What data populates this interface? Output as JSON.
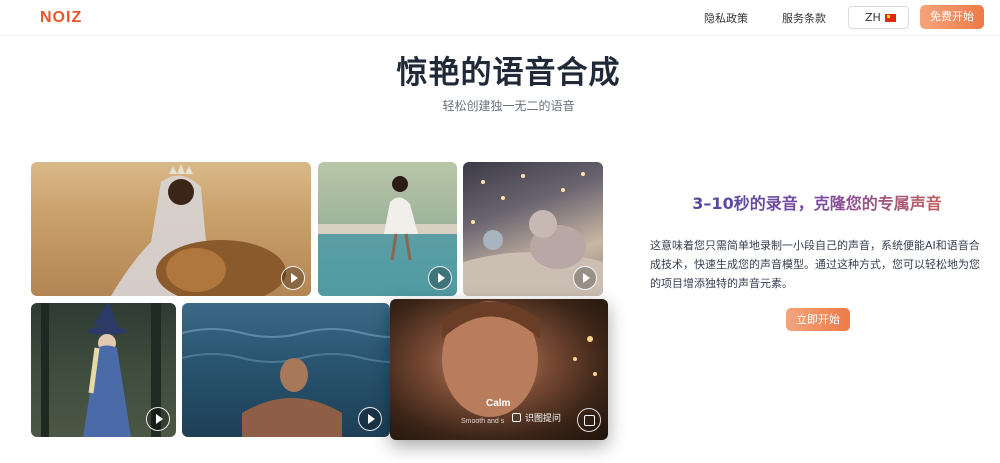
{
  "header": {
    "logo": "NOIZ",
    "nav": [
      "隐私政策",
      "服务条款"
    ],
    "lang": "ZH",
    "cta": "免费开始"
  },
  "hero": {
    "title": "惊艳的语音合成",
    "subtitle": "轻松创建独一无二的语音"
  },
  "tiles": {
    "featured": {
      "caption": "Calm",
      "subcaption": "Smooth and s",
      "lens_label": "识图提问"
    }
  },
  "feature": {
    "title": "3–10秒的录音，克隆您的专属声音",
    "body": "这意味着您只需简单地录制一小段自己的声音，系统便能AI和语音合成技术，快速生成您的声音模型。通过这种方式，您可以轻松地为您的项目增添独特的声音元素。",
    "cta": "立即开始"
  },
  "colors": {
    "brand": "#e8572a",
    "cta_start": "#f4a57b",
    "cta_end": "#ee7a47"
  },
  "icons": [
    "play-icon",
    "lens-icon",
    "flag-cn-icon"
  ]
}
